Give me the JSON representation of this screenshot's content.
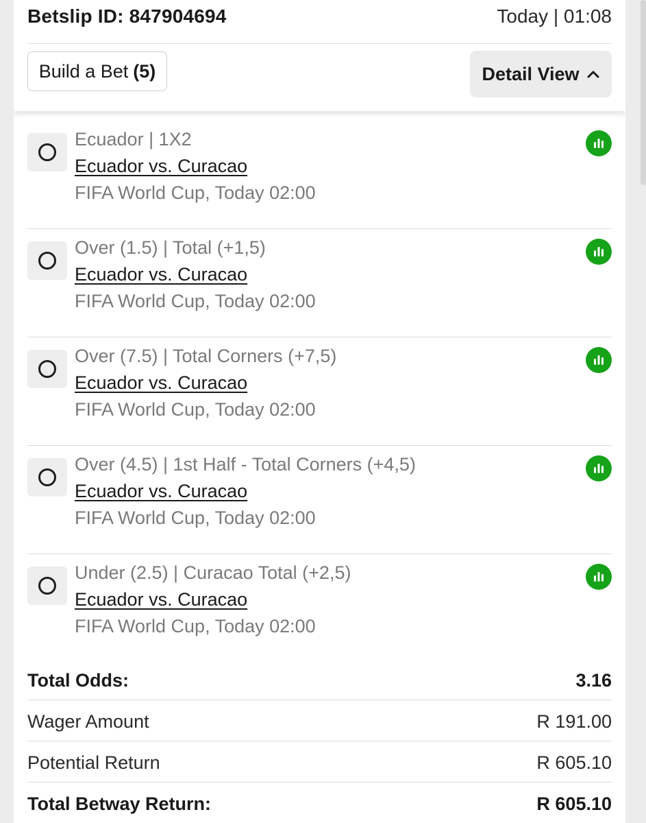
{
  "header": {
    "betslip_id_label": "Betslip ID: 847904694",
    "time": "Today | 01:08",
    "build_bet_label": "Build a Bet",
    "build_bet_count": "(5)",
    "detail_view_label": "Detail View"
  },
  "legs": [
    {
      "market": "Ecuador | 1X2",
      "match": "Ecuador vs. Curacao",
      "competition": "FIFA World Cup, Today 02:00"
    },
    {
      "market": "Over (1.5) | Total (+1,5)",
      "match": "Ecuador vs. Curacao",
      "competition": "FIFA World Cup, Today 02:00"
    },
    {
      "market": "Over (7.5) | Total Corners (+7,5)",
      "match": "Ecuador vs. Curacao",
      "competition": "FIFA World Cup, Today 02:00"
    },
    {
      "market": "Over (4.5) | 1st Half - Total Corners (+4,5)",
      "match": "Ecuador vs. Curacao",
      "competition": "FIFA World Cup, Today 02:00"
    },
    {
      "market": "Under (2.5) | Curacao Total (+2,5)",
      "match": "Ecuador vs. Curacao",
      "competition": "FIFA World Cup, Today 02:00"
    }
  ],
  "summary": {
    "total_odds_label": "Total Odds:",
    "total_odds_value": "3.16",
    "wager_label": "Wager Amount",
    "wager_value": "R 191.00",
    "potential_label": "Potential Return",
    "potential_value": "R 605.10",
    "betway_label": "Total Betway Return:",
    "betway_value": "R 605.10"
  },
  "colors": {
    "stats_icon_green": "#16a219",
    "background": "#ececec"
  },
  "icons": {
    "selection": "radio-circle-icon",
    "stats": "bar-chart-icon",
    "detail_toggle": "chevron-up-icon"
  }
}
